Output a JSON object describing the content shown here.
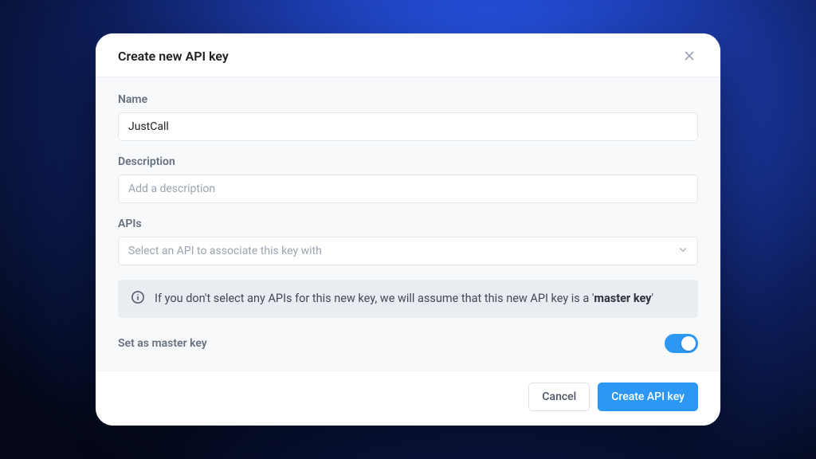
{
  "modal": {
    "title": "Create new API key",
    "name": {
      "label": "Name",
      "value": "JustCall"
    },
    "description": {
      "label": "Description",
      "placeholder": "Add a description",
      "value": ""
    },
    "apis": {
      "label": "APIs",
      "placeholder": "Select an API to associate this key with"
    },
    "info": {
      "prefix": "If you don't select any APIs for this new key, we will assume that this new API key is a '",
      "bold": "master key",
      "suffix": "'"
    },
    "master_toggle": {
      "label": "Set as master key",
      "on": true
    },
    "actions": {
      "cancel": "Cancel",
      "create": "Create API key"
    }
  }
}
